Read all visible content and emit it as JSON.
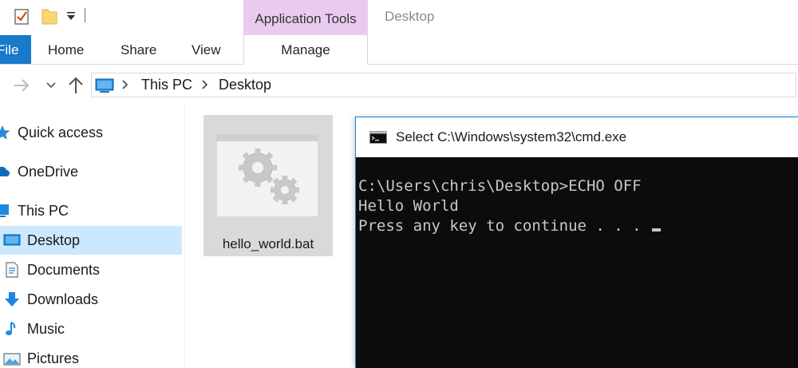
{
  "ribbon": {
    "file_tab": "File",
    "tabs": [
      "Home",
      "Share",
      "View"
    ],
    "context_group": "Application Tools",
    "context_tab": "Manage"
  },
  "window": {
    "title": "Desktop"
  },
  "address": {
    "crumbs": [
      "This PC",
      "Desktop"
    ]
  },
  "nav_pane": {
    "items": [
      {
        "label": "Quick access",
        "icon": "star-icon"
      },
      {
        "label": "OneDrive",
        "icon": "cloud-icon"
      },
      {
        "label": "This PC",
        "icon": "computer-icon"
      },
      {
        "label": "Desktop",
        "icon": "desktop-folder-icon",
        "selected": true
      },
      {
        "label": "Documents",
        "icon": "documents-icon"
      },
      {
        "label": "Downloads",
        "icon": "download-arrow-icon"
      },
      {
        "label": "Music",
        "icon": "music-note-icon"
      },
      {
        "label": "Pictures",
        "icon": "pictures-icon"
      }
    ]
  },
  "files": [
    {
      "name": "hello_world.bat",
      "icon": "batch-file-gears-icon"
    }
  ],
  "cmd": {
    "title": "Select C:\\Windows\\system32\\cmd.exe",
    "lines": [
      "C:\\Users\\chris\\Desktop>ECHO OFF",
      "Hello World",
      "Press any key to continue . . . "
    ]
  },
  "colors": {
    "accent": "#1979ca",
    "context_tab": "#e9cbf0",
    "selected_nav": "#cce8ff",
    "console_bg": "#0c0c0c",
    "console_text": "#c8c8c8"
  }
}
